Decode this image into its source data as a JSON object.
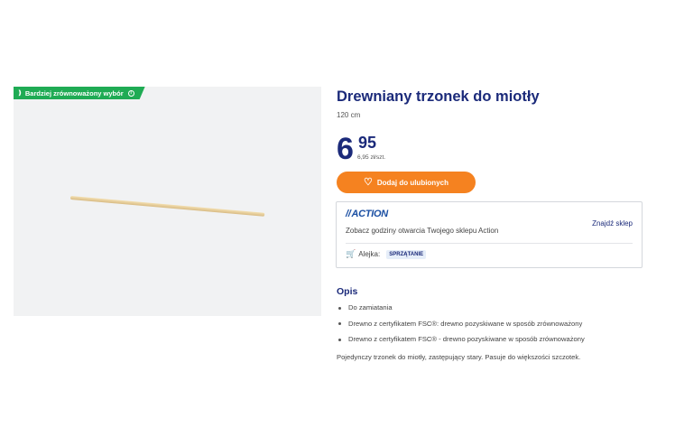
{
  "product": {
    "badge": "Bardziej zrównoważony wybór",
    "title": "Drewniany trzonek do miotły",
    "size": "120 cm",
    "price_int": "6",
    "price_dec": "95",
    "unit_price": "6,95 zł/szt.",
    "favorite_label": "Dodaj do ulubionych"
  },
  "store": {
    "logo": "ACTION",
    "hours_text": "Zobacz godziny otwarcia Twojego sklepu Action",
    "find_store": "Znajdź sklep",
    "aisle_label": "Alejka:",
    "aisle_value": "SPRZĄTANIE"
  },
  "description": {
    "title": "Opis",
    "bullets": [
      "Do zamiatania",
      "Drewno z certyfikatem FSC®: drewno pozyskiwane w sposób zrównoważony",
      "Drewno z certyfikatem FSC® - drewno pozyskiwane w sposób zrównoważony"
    ],
    "text": "Pojedynczy trzonek do miotły, zastępujący stary. Pasuje do większości szczotek."
  },
  "colors": {
    "brand_blue": "#1b2a7a",
    "orange": "#f58220",
    "green": "#1fab54"
  }
}
